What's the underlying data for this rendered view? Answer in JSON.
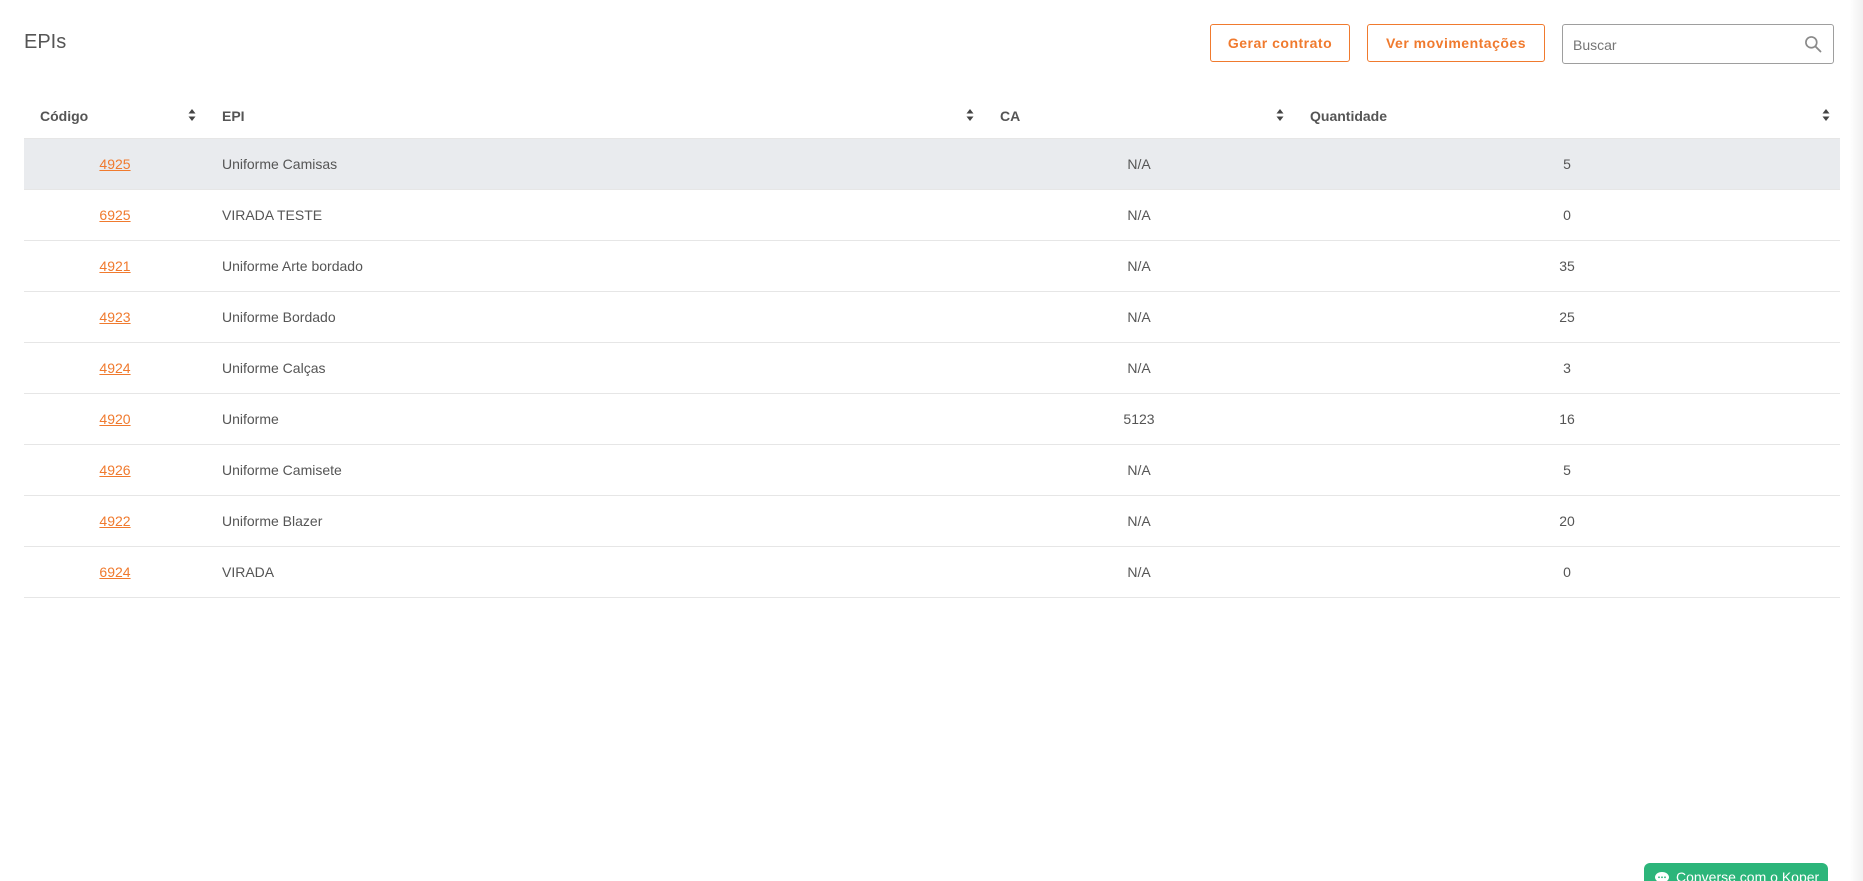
{
  "header": {
    "title": "EPIs",
    "gerar_contrato_label": "Gerar contrato",
    "ver_movimentacoes_label": "Ver movimentações",
    "search_placeholder": "Buscar",
    "search_value": ""
  },
  "table": {
    "columns": [
      {
        "label": "Código",
        "icon": "sort-icon"
      },
      {
        "label": "EPI",
        "icon": "sort-icon"
      },
      {
        "label": "CA",
        "icon": "sort-icon"
      },
      {
        "label": "Quantidade",
        "icon": "sort-icon"
      }
    ],
    "rows": [
      {
        "codigo": "4925",
        "epi": "Uniforme Camisas",
        "ca": "N/A",
        "quantidade": "5",
        "highlighted": true
      },
      {
        "codigo": "6925",
        "epi": "VIRADA TESTE",
        "ca": "N/A",
        "quantidade": "0"
      },
      {
        "codigo": "4921",
        "epi": "Uniforme Arte bordado",
        "ca": "N/A",
        "quantidade": "35"
      },
      {
        "codigo": "4923",
        "epi": "Uniforme Bordado",
        "ca": "N/A",
        "quantidade": "25"
      },
      {
        "codigo": "4924",
        "epi": "Uniforme Calças",
        "ca": "N/A",
        "quantidade": "3"
      },
      {
        "codigo": "4920",
        "epi": "Uniforme",
        "ca": "5123",
        "quantidade": "16"
      },
      {
        "codigo": "4926",
        "epi": "Uniforme Camisete",
        "ca": "N/A",
        "quantidade": "5"
      },
      {
        "codigo": "4922",
        "epi": "Uniforme Blazer",
        "ca": "N/A",
        "quantidade": "20"
      },
      {
        "codigo": "6924",
        "epi": "VIRADA",
        "ca": "N/A",
        "quantidade": "0"
      }
    ]
  },
  "chat": {
    "label": "Converse com o Koper",
    "icon": "chat-bubble-icon"
  },
  "colors": {
    "accent": "#f07a2e",
    "row_highlight": "#e9ebee",
    "chat": "#2cb57a"
  }
}
